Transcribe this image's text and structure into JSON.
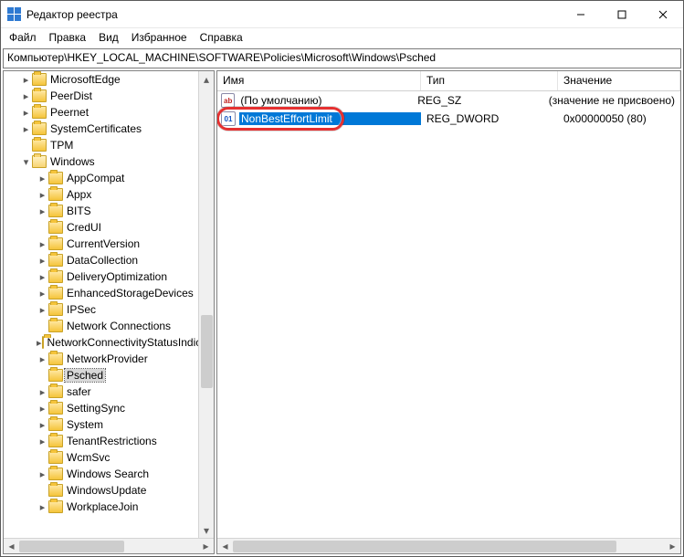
{
  "window": {
    "title": "Редактор реестра"
  },
  "menu": {
    "file": "Файл",
    "edit": "Правка",
    "view": "Вид",
    "favorites": "Избранное",
    "help": "Справка"
  },
  "address": "Компьютер\\HKEY_LOCAL_MACHINE\\SOFTWARE\\Policies\\Microsoft\\Windows\\Psched",
  "tree": [
    {
      "indent": 1,
      "exp": "closed",
      "open": false,
      "label": "MicrosoftEdge"
    },
    {
      "indent": 1,
      "exp": "closed",
      "open": false,
      "label": "PeerDist"
    },
    {
      "indent": 1,
      "exp": "closed",
      "open": false,
      "label": "Peernet"
    },
    {
      "indent": 1,
      "exp": "closed",
      "open": false,
      "label": "SystemCertificates"
    },
    {
      "indent": 1,
      "exp": "none",
      "open": false,
      "label": "TPM"
    },
    {
      "indent": 1,
      "exp": "open",
      "open": true,
      "label": "Windows"
    },
    {
      "indent": 2,
      "exp": "closed",
      "open": false,
      "label": "AppCompat"
    },
    {
      "indent": 2,
      "exp": "closed",
      "open": false,
      "label": "Appx"
    },
    {
      "indent": 2,
      "exp": "closed",
      "open": false,
      "label": "BITS"
    },
    {
      "indent": 2,
      "exp": "none",
      "open": false,
      "label": "CredUI"
    },
    {
      "indent": 2,
      "exp": "closed",
      "open": false,
      "label": "CurrentVersion"
    },
    {
      "indent": 2,
      "exp": "closed",
      "open": false,
      "label": "DataCollection"
    },
    {
      "indent": 2,
      "exp": "closed",
      "open": false,
      "label": "DeliveryOptimization"
    },
    {
      "indent": 2,
      "exp": "closed",
      "open": false,
      "label": "EnhancedStorageDevices"
    },
    {
      "indent": 2,
      "exp": "closed",
      "open": false,
      "label": "IPSec"
    },
    {
      "indent": 2,
      "exp": "none",
      "open": false,
      "label": "Network Connections"
    },
    {
      "indent": 2,
      "exp": "closed",
      "open": false,
      "label": "NetworkConnectivityStatusIndicator"
    },
    {
      "indent": 2,
      "exp": "closed",
      "open": false,
      "label": "NetworkProvider"
    },
    {
      "indent": 2,
      "exp": "none",
      "open": false,
      "label": "Psched",
      "selected": true
    },
    {
      "indent": 2,
      "exp": "closed",
      "open": false,
      "label": "safer"
    },
    {
      "indent": 2,
      "exp": "closed",
      "open": false,
      "label": "SettingSync"
    },
    {
      "indent": 2,
      "exp": "closed",
      "open": false,
      "label": "System"
    },
    {
      "indent": 2,
      "exp": "closed",
      "open": false,
      "label": "TenantRestrictions"
    },
    {
      "indent": 2,
      "exp": "none",
      "open": false,
      "label": "WcmSvc"
    },
    {
      "indent": 2,
      "exp": "closed",
      "open": false,
      "label": "Windows Search"
    },
    {
      "indent": 2,
      "exp": "none",
      "open": false,
      "label": "WindowsUpdate"
    },
    {
      "indent": 2,
      "exp": "closed",
      "open": false,
      "label": "WorkplaceJoin"
    }
  ],
  "list": {
    "headers": {
      "name": "Имя",
      "type": "Тип",
      "value": "Значение"
    },
    "rows": [
      {
        "icon": "str",
        "name": "(По умолчанию)",
        "type": "REG_SZ",
        "value": "(значение не присвоено)",
        "selected": false
      },
      {
        "icon": "dw",
        "name": "NonBestEffortLimit",
        "type": "REG_DWORD",
        "value": "0x00000050 (80)",
        "selected": true,
        "highlight": true
      }
    ]
  },
  "icons": {
    "ab": "ab",
    "nn": "011\n110"
  }
}
